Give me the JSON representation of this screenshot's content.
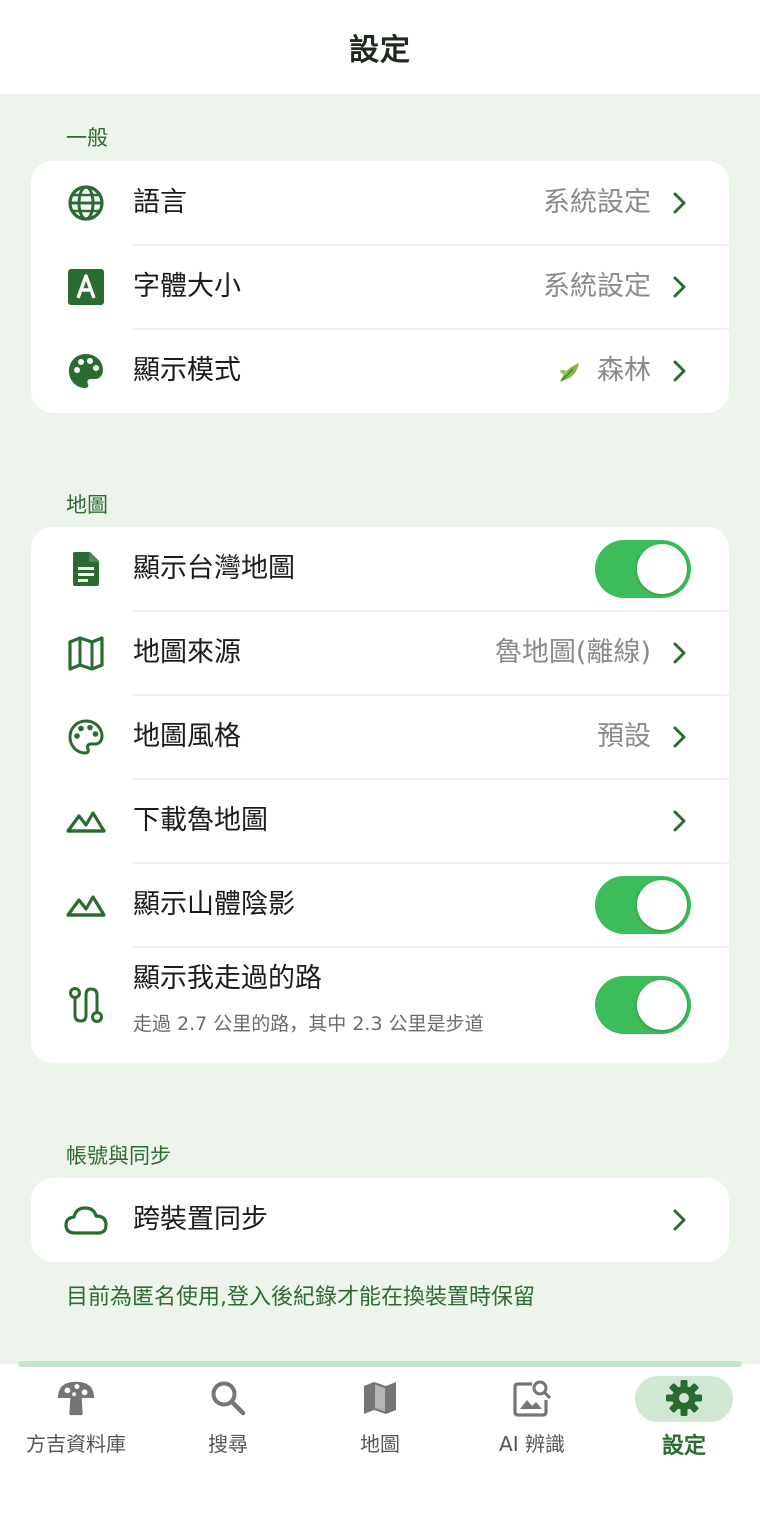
{
  "header": {
    "title": "設定"
  },
  "sections": {
    "general": {
      "label": "一般",
      "language": {
        "label": "語言",
        "value": "系統設定",
        "icon": "globe-icon"
      },
      "font_size": {
        "label": "字體大小",
        "value": "系統設定",
        "icon": "letter-a-icon"
      },
      "display_mode": {
        "label": "顯示模式",
        "value": "森林",
        "icon": "palette-icon",
        "badge_icon": "leaf-icon"
      }
    },
    "map": {
      "label": "地圖",
      "show_taiwan_map": {
        "label": "顯示台灣地圖",
        "on": true,
        "icon": "document-icon"
      },
      "map_source": {
        "label": "地圖來源",
        "value": "魯地圖(離線)",
        "icon": "map-icon"
      },
      "map_style": {
        "label": "地圖風格",
        "value": "預設",
        "icon": "palette-outline-icon"
      },
      "download_map": {
        "label": "下載魯地圖",
        "icon": "mountain-icon"
      },
      "hillshade": {
        "label": "顯示山體陰影",
        "on": true,
        "icon": "mountain-icon"
      },
      "my_paths": {
        "label": "顯示我走過的路",
        "sublabel": "走過 2.7 公里的路，其中 2.3 公里是步道",
        "on": true,
        "icon": "route-icon"
      }
    },
    "account": {
      "label": "帳號與同步",
      "sync": {
        "label": "跨裝置同步",
        "icon": "cloud-icon"
      },
      "note": "目前為匿名使用,登入後紀錄才能在換裝置時保留"
    }
  },
  "tabbar": {
    "tabs": [
      {
        "label": "方吉資料庫",
        "icon": "mushroom-icon"
      },
      {
        "label": "搜尋",
        "icon": "search-icon"
      },
      {
        "label": "地圖",
        "icon": "map-icon"
      },
      {
        "label": "AI 辨識",
        "icon": "image-search-icon"
      },
      {
        "label": "設定",
        "icon": "gear-icon",
        "active": true
      }
    ]
  },
  "colors": {
    "accent": "#2a6b30",
    "toggle_on": "#3cbd5a",
    "background": "#edf4ec"
  }
}
